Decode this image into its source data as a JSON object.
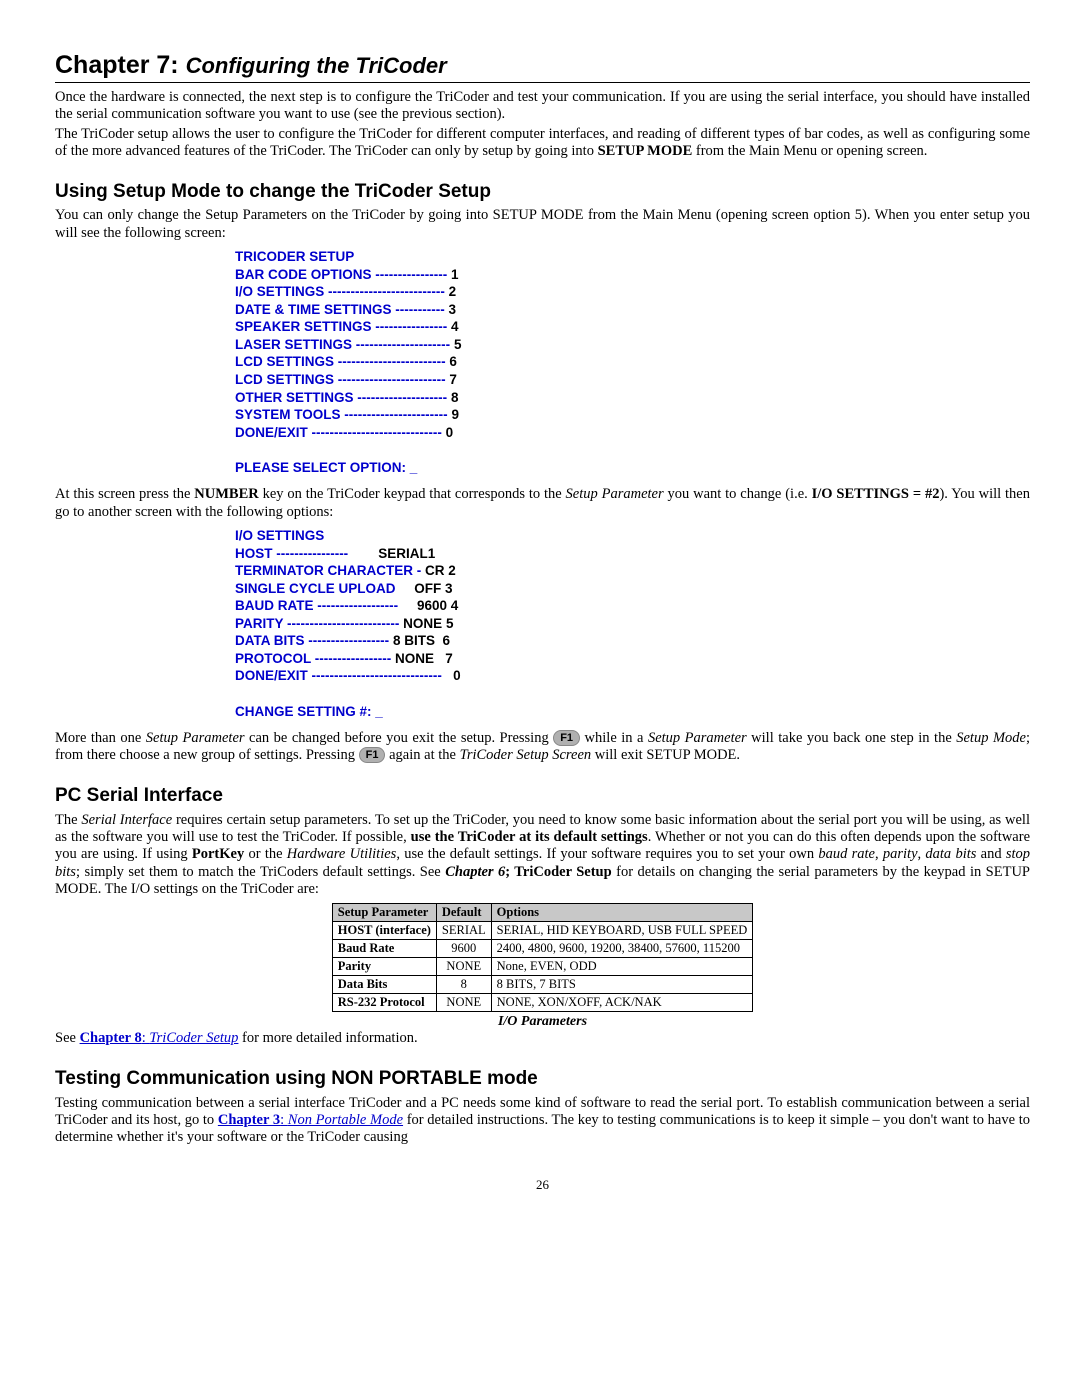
{
  "chapter": {
    "prefix": "Chapter 7:",
    "title": "Configuring the TriCoder"
  },
  "intro": {
    "p1a": "Once the hardware is connected, the next step is to configure the TriCoder and test your communication.  If you are using the serial interface, you should have installed the serial communication software you want to use (see the previous section).",
    "p2a": "The TriCoder setup allows the user to configure the TriCoder for different computer interfaces, and reading of different types of bar codes, as well as configuring some of the more advanced features of the TriCoder.  The TriCoder can only by setup by going into ",
    "p2b": "SETUP MODE",
    "p2c": " from the Main Menu or opening screen."
  },
  "h_using": "Using Setup Mode to change the TriCoder Setup",
  "using_p1": "You can only change the Setup Parameters on the TriCoder by going into SETUP MODE from the Main Menu (opening screen option 5).  When you enter setup you will see the following screen:",
  "menu1": {
    "title": "TRICODER SETUP",
    "l1": "BAR CODE OPTIONS ----------------",
    "n1": "1",
    "l2": "I/O SETTINGS --------------------------",
    "n2": "2",
    "l3": "DATE & TIME SETTINGS -----------",
    "n3": "3",
    "l4": "SPEAKER SETTINGS ----------------",
    "n4": "4",
    "l5": "LASER SETTINGS ---------------------",
    "n5": "5",
    "l6": "LCD SETTINGS ------------------------",
    "n6": "6",
    "l7": "LCD SETTINGS ------------------------",
    "n7": "7",
    "l8": "OTHER SETTINGS --------------------",
    "n8": "8",
    "l9": "SYSTEM TOOLS -----------------------",
    "n9": "9",
    "l10": "DONE/EXIT -----------------------------",
    "n10": "0",
    "prompt": "PLEASE SELECT OPTION:  _"
  },
  "using_p2": {
    "a": "At this screen press the ",
    "b": "NUMBER",
    "c": " key on the TriCoder keypad that corresponds to the ",
    "d": "Setup Parameter",
    "e": " you want to change (i.e. ",
    "f": "I/O SETTINGS = #2",
    "g": ").  You will then go to another screen with the following options:"
  },
  "menu2": {
    "title": "I/O SETTINGS",
    "l1a": "HOST  ----------------",
    "l1b": "SERIAL",
    "n1": "1",
    "l2a": "TERMINATOR CHARACTER - ",
    "l2b": "CR",
    "n2": "2",
    "l3a": "SINGLE CYCLE UPLOAD",
    "l3b": "OFF",
    "n3": "3",
    "l4a": "BAUD RATE ------------------",
    "l4b": "9600",
    "n4": "4",
    "l5a": "PARITY  -------------------------",
    "l5b": "NONE",
    "n5": "5",
    "l6a": "DATA BITS  ------------------",
    "l6b": "8 BITS",
    "n6": "6",
    "l7a": "PROTOCOL -----------------",
    "l7b": "NONE",
    "n7": "7",
    "l8a": "DONE/EXIT -----------------------------",
    "n8": "0",
    "prompt": "CHANGE SETTING #:   _"
  },
  "using_p3": {
    "a": "More than one ",
    "b": "Setup Parameter",
    "c": " can be changed before you exit the setup.  Pressing ",
    "f1a": "F1",
    "d": " while in a ",
    "e": "Setup Parameter",
    "f": " will take you back one step in the ",
    "g": "Setup Mode",
    "h": "; from there choose a new group of settings.  Pressing ",
    "f1b": "F1",
    "i": " again at the ",
    "j": "TriCoder Setup Screen",
    "k": " will exit SETUP MODE."
  },
  "h_pcserial": "PC Serial Interface",
  "pc_p1": {
    "a": "The ",
    "b": "Serial Interface",
    "c": " requires certain setup parameters.  To set up the TriCoder, you need to know some basic information about the serial port you will be using, as well as the software you will use to test the TriCoder.  If possible, ",
    "d": "use the TriCoder at its default settings",
    "e": ". Whether or not you can do this often depends upon the software you are using.  If using ",
    "f": "PortKey",
    "g": " or the ",
    "h": "Hardware Utilities",
    "i": ", use the default settings.  If your software requires you to set your own ",
    "j": "baud rate",
    "k": ", ",
    "l": "parity",
    "m": ", ",
    "n": "data bits",
    "o": " and ",
    "p": "stop bits",
    "q": "; simply set them to match the TriCoders default settings.  See ",
    "r": "Chapter 6",
    "s": "; TriCoder Setup",
    "t": " for details on changing the serial parameters by the keypad in SETUP MODE.  The I/O settings on the TriCoder are:"
  },
  "table": {
    "h1": "Setup Parameter",
    "h2": "Default",
    "h3": "Options",
    "r1c1": "HOST (interface)",
    "r1c2": "SERIAL",
    "r1c3": "SERIAL, HID KEYBOARD, USB FULL SPEED",
    "r2c1": "Baud Rate",
    "r2c2": "9600",
    "r2c3": "2400, 4800, 9600, 19200, 38400, 57600, 115200",
    "r3c1": "Parity",
    "r3c2": "NONE",
    "r3c3": "None, EVEN, ODD",
    "r4c1": "Data Bits",
    "r4c2": "8",
    "r4c3": "8 BITS, 7 BITS",
    "r5c1": "RS-232 Protocol",
    "r5c2": "NONE",
    "r5c3": "NONE, XON/XOFF, ACK/NAK"
  },
  "table_caption": "I/O Parameters",
  "see_line": {
    "a": "See ",
    "link_b": "Chapter 8",
    "link_sep": ": ",
    "link_i": "TriCoder Setup",
    "c": " for more detailed information."
  },
  "h_testing": "Testing Communication using NON PORTABLE mode",
  "test_p1": {
    "a": "Testing communication between a serial interface TriCoder and a PC needs some kind of software to read the serial port.  To establish communication between a serial TriCoder and its host, go to ",
    "link_b": "Chapter 3",
    "link_sep": ": ",
    "link_i": "Non Portable Mode",
    "b": " for detailed instructions. The key to testing communications is to keep it simple – you don't want to have to determine whether it's your software or the TriCoder causing"
  },
  "page_number": "26"
}
